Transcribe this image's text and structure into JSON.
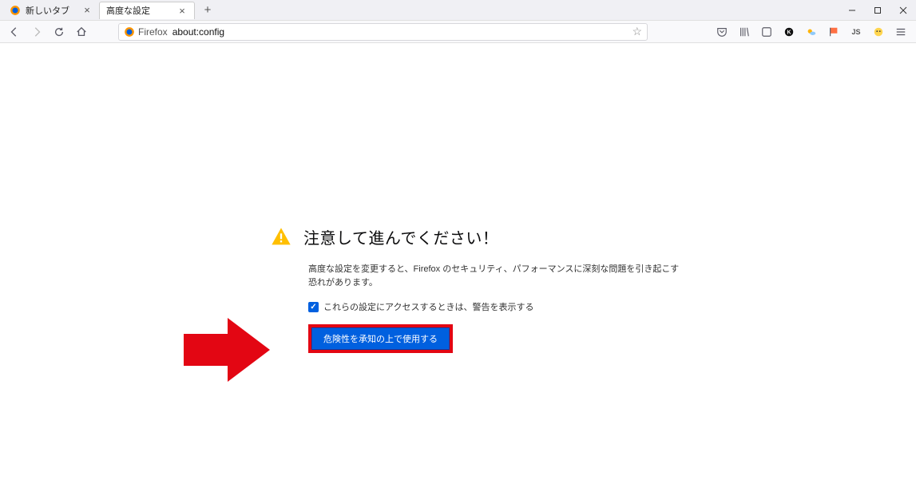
{
  "tabs": [
    {
      "label": "新しいタブ",
      "active": false
    },
    {
      "label": "高度な設定",
      "active": true
    }
  ],
  "window_controls": {
    "minimize": "minimize",
    "maximize": "maximize",
    "close": "close"
  },
  "urlbar": {
    "identity_label": "Firefox",
    "url": "about:config"
  },
  "toolbar_icons": [
    "pocket-icon",
    "library-icon",
    "container-icon",
    "adblock-icon",
    "weather-icon",
    "flag-icon",
    "js-icon",
    "extension-icon",
    "menu-icon"
  ],
  "warning": {
    "title": "注意して進んでください！",
    "description": "高度な設定を変更すると、Firefox のセキュリティ、パフォーマンスに深刻な問題を引き起こす恐れがあります。",
    "checkbox_label": "これらの設定にアクセスするときは、警告を表示する",
    "button_label": "危険性を承知の上で使用する"
  },
  "colors": {
    "accent": "#0060df",
    "annotation": "#e30613",
    "warn_icon": "#ffbf00"
  }
}
